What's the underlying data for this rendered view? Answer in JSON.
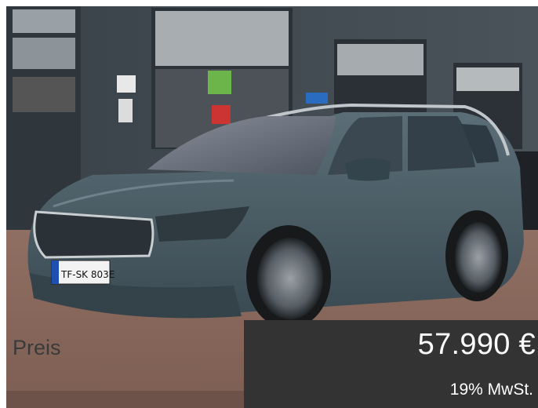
{
  "photo": {
    "subject": "car-photo",
    "plate_text": "TF-SK 803E"
  },
  "price": {
    "label": "Preis",
    "amount": "57.990 €",
    "tax_note": "19% MwSt."
  },
  "colors": {
    "price_box_bg": "#333333",
    "label_text": "#3a3a3a",
    "car_body": "#475a63"
  }
}
